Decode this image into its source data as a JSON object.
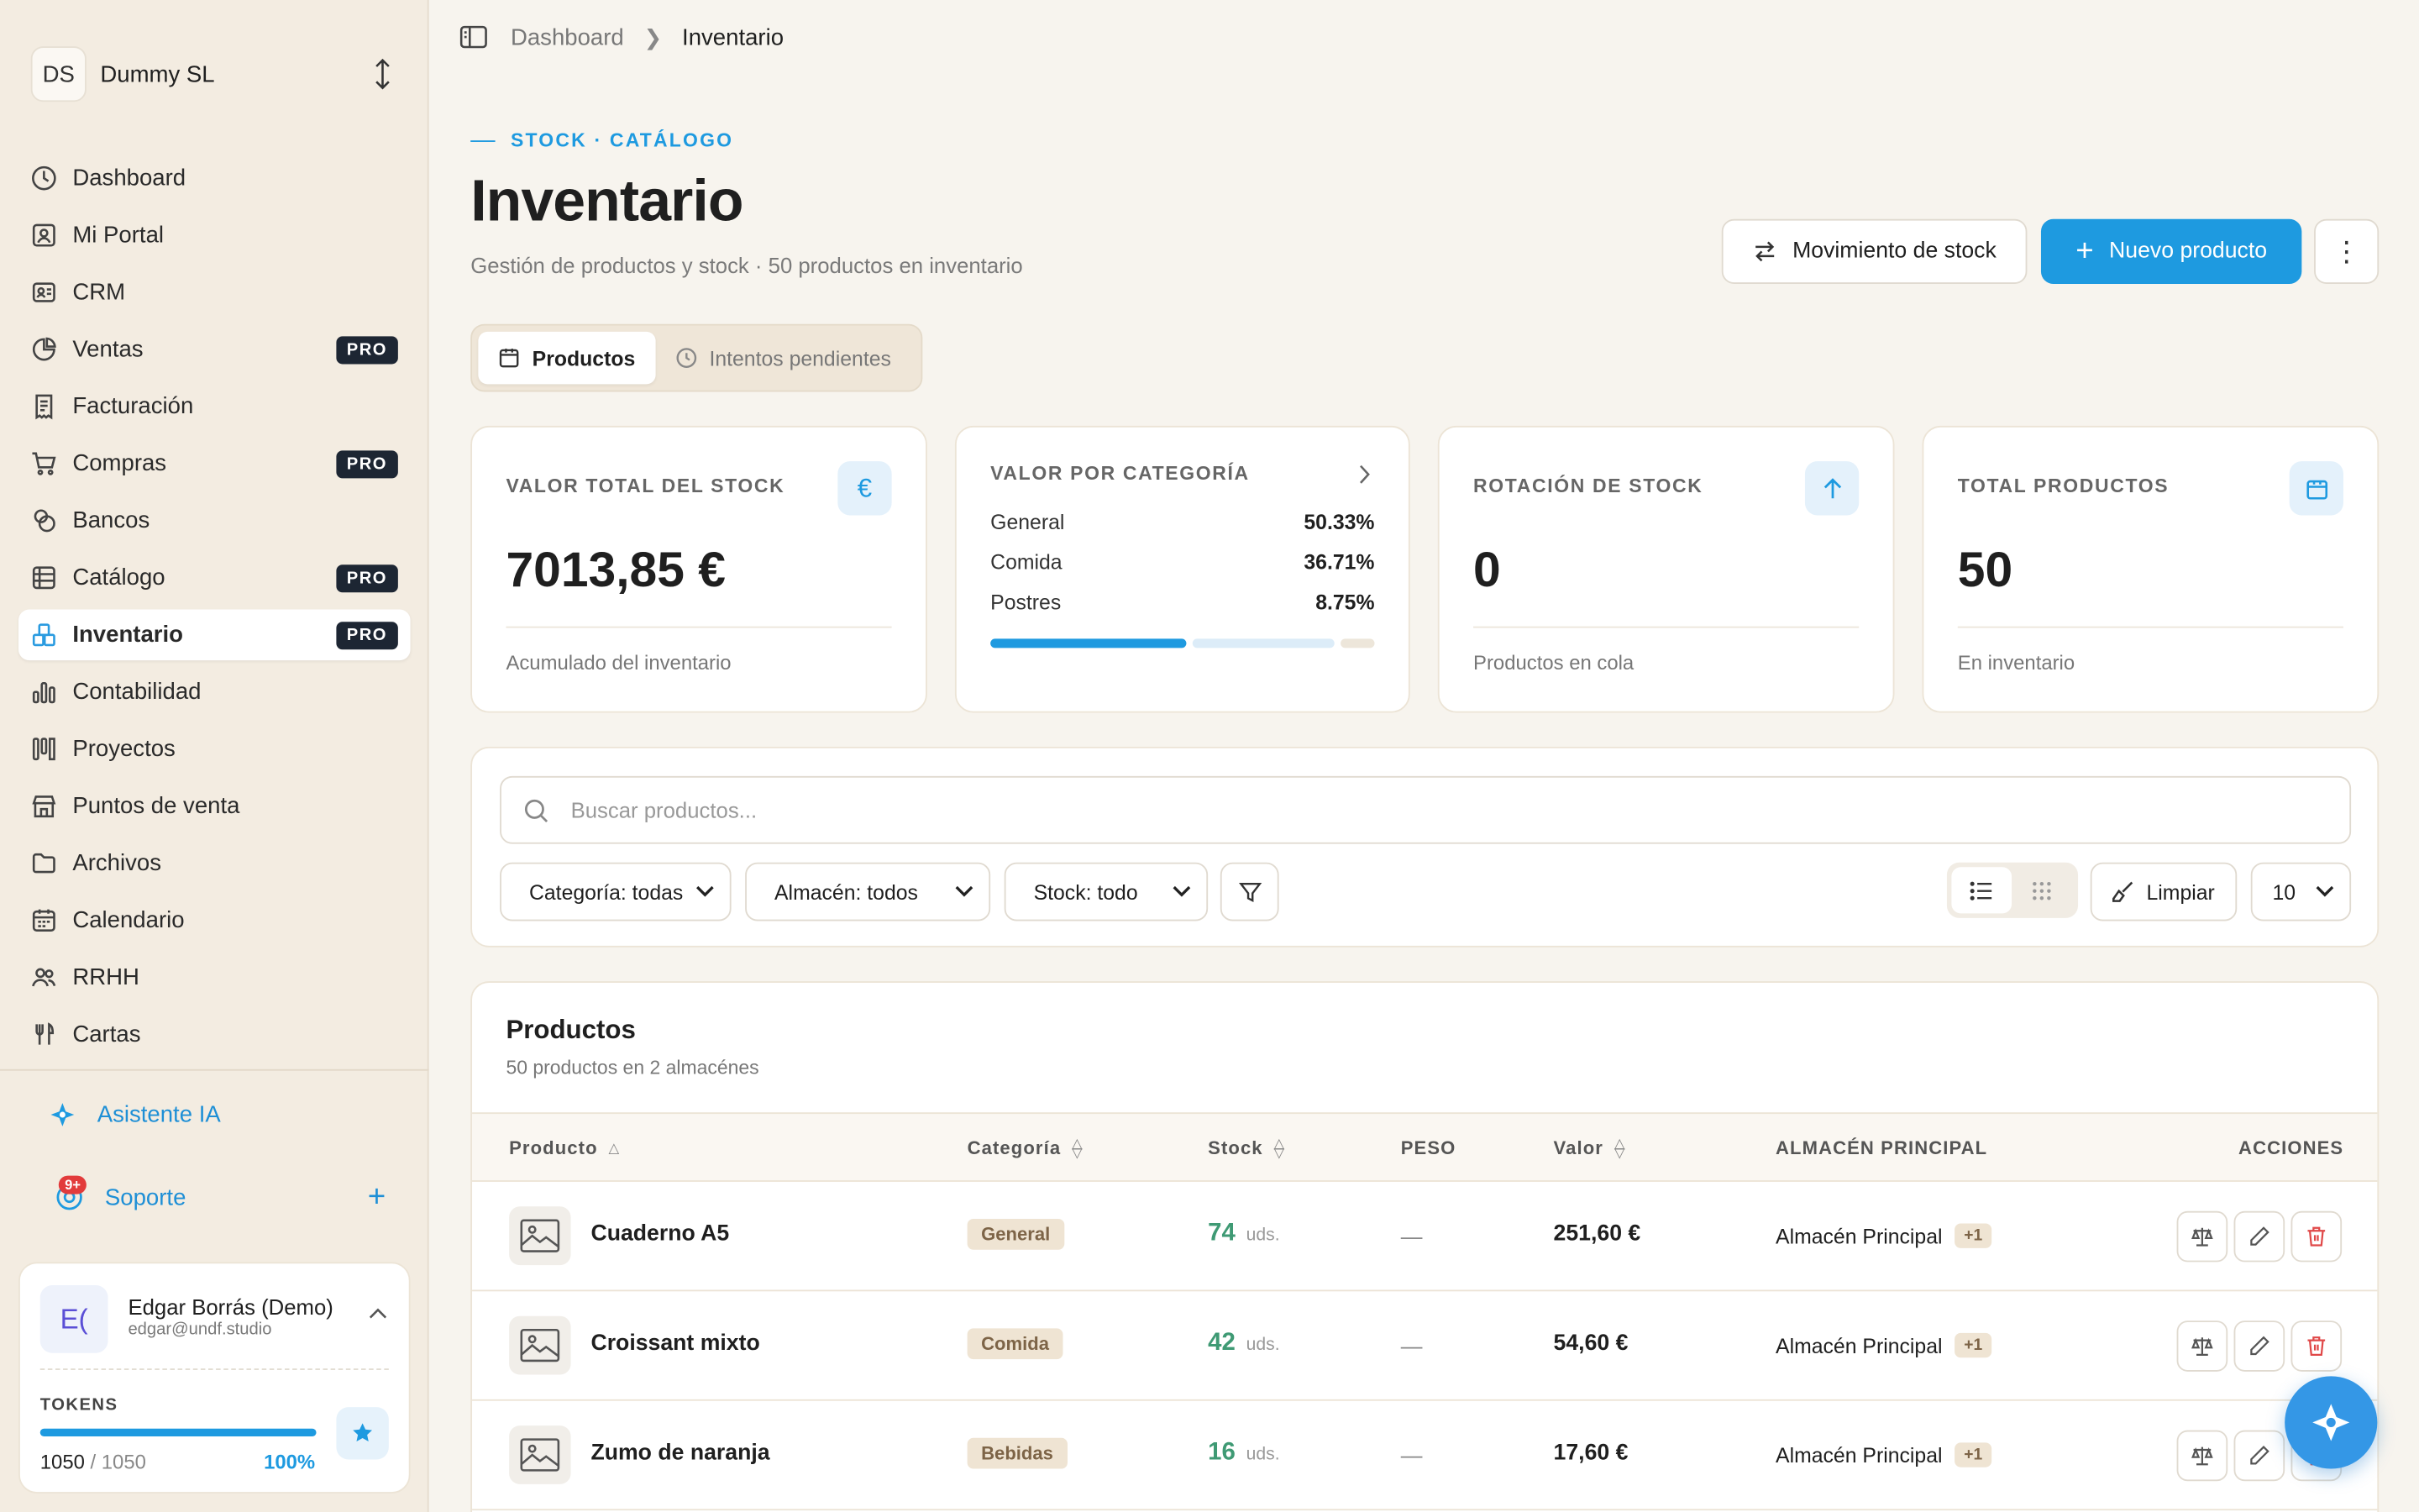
{
  "workspace": {
    "initials": "DS",
    "name": "Dummy SL"
  },
  "nav": [
    {
      "label": "Dashboard",
      "icon": "dashboard-icon",
      "pro": false
    },
    {
      "label": "Mi Portal",
      "icon": "portal-icon",
      "pro": false
    },
    {
      "label": "CRM",
      "icon": "crm-icon",
      "pro": false
    },
    {
      "label": "Ventas",
      "icon": "sales-icon",
      "pro": true
    },
    {
      "label": "Facturación",
      "icon": "invoice-icon",
      "pro": false
    },
    {
      "label": "Compras",
      "icon": "cart-icon",
      "pro": true
    },
    {
      "label": "Bancos",
      "icon": "bank-icon",
      "pro": false
    },
    {
      "label": "Catálogo",
      "icon": "catalog-icon",
      "pro": true
    },
    {
      "label": "Inventario",
      "icon": "inventory-icon",
      "pro": true,
      "active": true
    },
    {
      "label": "Contabilidad",
      "icon": "chart-icon",
      "pro": false
    },
    {
      "label": "Proyectos",
      "icon": "projects-icon",
      "pro": false
    },
    {
      "label": "Puntos de venta",
      "icon": "pos-icon",
      "pro": false
    },
    {
      "label": "Archivos",
      "icon": "folder-icon",
      "pro": false
    },
    {
      "label": "Calendario",
      "icon": "calendar-icon",
      "pro": false
    },
    {
      "label": "RRHH",
      "icon": "people-icon",
      "pro": false
    },
    {
      "label": "Cartas",
      "icon": "menu-icon",
      "pro": false
    }
  ],
  "pro_label": "PRO",
  "assistant": "Asistente IA",
  "support": {
    "label": "Soporte",
    "badge": "9+"
  },
  "user": {
    "initials": "E(",
    "name": "Edgar Borrás (Demo)",
    "email": "edgar@undf.studio",
    "tokens_label": "TOKENS",
    "tokens_used": "1050",
    "tokens_total": " / 1050",
    "tokens_pct": "100%",
    "tokens_fraction": 1.0
  },
  "breadcrumb": {
    "parent": "Dashboard",
    "current": "Inventario"
  },
  "header": {
    "eyebrow": "STOCK · CATÁLOGO",
    "title": "Inventario",
    "subtitle": "Gestión de productos y stock · 50 productos en inventario",
    "move_button": "Movimiento de stock",
    "new_button": "Nuevo producto"
  },
  "tabs": [
    {
      "label": "Productos",
      "active": true
    },
    {
      "label": "Intentos pendientes",
      "active": false
    }
  ],
  "stats": {
    "total_value": {
      "label": "VALOR TOTAL DEL STOCK",
      "value": "7013,85 €",
      "foot": "Acumulado del inventario",
      "icon": "€"
    },
    "by_category": {
      "label": "VALOR POR CATEGORÍA",
      "rows": [
        {
          "name": "General",
          "pct": "50.33%"
        },
        {
          "name": "Comida",
          "pct": "36.71%"
        },
        {
          "name": "Postres",
          "pct": "8.75%"
        }
      ],
      "shares": [
        50.33,
        36.71,
        8.75
      ],
      "bar_colors": [
        "#1e9ae0",
        "#dcecf8",
        "#ede6da"
      ]
    },
    "rotation": {
      "label": "ROTACIÓN DE STOCK",
      "value": "0",
      "foot": "Productos en cola"
    },
    "total_products": {
      "label": "TOTAL PRODUCTOS",
      "value": "50",
      "foot": "En inventario"
    }
  },
  "filters": {
    "search_placeholder": "Buscar productos...",
    "category": "Categoría: todas",
    "warehouse": "Almacén: todos",
    "stock": "Stock: todo",
    "clear": "Limpiar",
    "page_size": "10"
  },
  "table": {
    "title": "Productos",
    "subtitle": "50 productos en 2 almacénes",
    "columns": {
      "product": "Producto",
      "category": "Categoría",
      "stock": "Stock",
      "weight": "PESO",
      "value": "Valor",
      "warehouse": "ALMACÉN PRINCIPAL",
      "actions": "ACCIONES"
    },
    "rows": [
      {
        "name": "Cuaderno A5",
        "category": "General",
        "stock": "74",
        "unit": "uds.",
        "weight": "—",
        "value": "251,60 €",
        "warehouse": "Almacén Principal",
        "more": "+1"
      },
      {
        "name": "Croissant mixto",
        "category": "Comida",
        "stock": "42",
        "unit": "uds.",
        "weight": "—",
        "value": "54,60 €",
        "warehouse": "Almacén Principal",
        "more": "+1"
      },
      {
        "name": "Zumo de naranja",
        "category": "Bebidas",
        "stock": "16",
        "unit": "uds.",
        "weight": "—",
        "value": "17,60 €",
        "warehouse": "Almacén Principal",
        "more": "+1"
      }
    ]
  },
  "colors": {
    "accent": "#1e9ae0",
    "stock_green": "#3f9a74",
    "danger": "#e04848",
    "pro_badge": "#1d2633"
  }
}
